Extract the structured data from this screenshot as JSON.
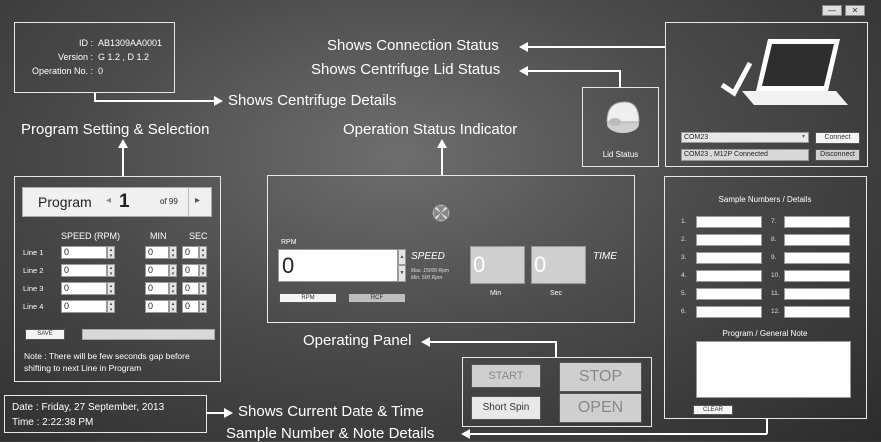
{
  "window": {
    "minimize_label": "—",
    "close_label": "✕"
  },
  "device": {
    "id_label": "ID :",
    "id_value": "AB1309AA0001",
    "version_label": "Version :",
    "version_value": "G 1.2 , D 1.2",
    "opno_label": "Operation No. :",
    "opno_value": "0"
  },
  "callouts": {
    "connection": "Shows Connection Status",
    "lid": "Shows Centrifuge Lid Status",
    "details": "Shows Centrifuge Details",
    "program": "Program Setting & Selection",
    "operation": "Operation Status Indicator",
    "panel": "Operating Panel",
    "datetime": "Shows Current Date & Time",
    "sample": "Sample Number & Note Details"
  },
  "lid": {
    "label": "Lid Status"
  },
  "connection": {
    "port_value": "COM23",
    "connect_label": "Connect",
    "status_value": "COM23 , M12P Connected",
    "disconnect_label": "Disconnect"
  },
  "program": {
    "title": "Program",
    "number": "1",
    "of_label": "of 99",
    "prev_icon": "◂",
    "next_icon": "▸",
    "col_speed": "SPEED  (RPM)",
    "col_min": "MIN",
    "col_sec": "SEC",
    "lines": [
      {
        "label": "Line 1",
        "speed": "0",
        "min": "0",
        "sec": "0"
      },
      {
        "label": "Line 2",
        "speed": "0",
        "min": "0",
        "sec": "0"
      },
      {
        "label": "Line 3",
        "speed": "0",
        "min": "0",
        "sec": "0"
      },
      {
        "label": "Line 4",
        "speed": "0",
        "min": "0",
        "sec": "0"
      }
    ],
    "save_label": "SAVE",
    "note": "Note : There will be few seconds gap before shifting to next Line in Program"
  },
  "status": {
    "rpm_label": "RPM",
    "rpm_value": "0",
    "speed_label": "SPEED",
    "max_label": "Max. 15000 Rpm",
    "min_label": "Min. 500 Rpm",
    "min_value": "0",
    "sec_value": "0",
    "time_label": "TIME",
    "min_caption": "Min",
    "sec_caption": "Sec",
    "rpm_btn": "RPM",
    "rcf_btn": "RCF"
  },
  "panel": {
    "start": "START",
    "stop": "STOP",
    "short_spin": "Short Spin",
    "open": "OPEN"
  },
  "datetime": {
    "date": "Date : Friday, 27 September, 2013",
    "time": "Time : 2:22:38 PM"
  },
  "samples": {
    "title": "Sample Numbers / Details",
    "left_numbers": [
      "1.",
      "2.",
      "3.",
      "4.",
      "5.",
      "6."
    ],
    "right_numbers": [
      "7.",
      "8.",
      "9.",
      "10.",
      "11.",
      "12."
    ],
    "note_title": "Program / General  Note",
    "clear_label": "CLEAR"
  }
}
